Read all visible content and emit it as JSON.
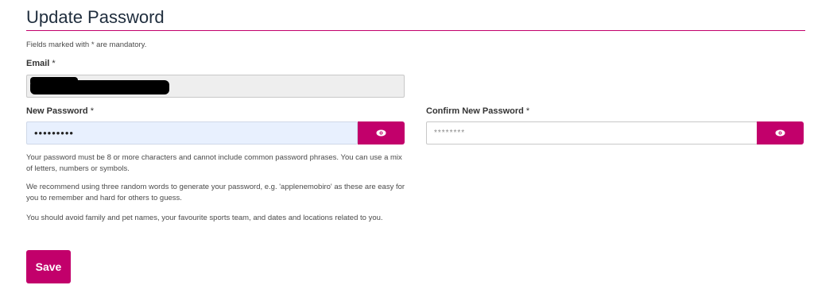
{
  "page": {
    "title": "Update Password",
    "mandatory_note": "Fields marked with * are mandatory."
  },
  "email": {
    "label": "Email",
    "required_mark": "*"
  },
  "new_password": {
    "label": "New Password",
    "required_mark": "*",
    "value": "•••••••••",
    "toggle_icon": "eye-icon"
  },
  "confirm_password": {
    "label": "Confirm New Password",
    "required_mark": "*",
    "placeholder": "********",
    "toggle_icon": "eye-icon"
  },
  "help": {
    "paragraph_1": "Your password must be 8 or more characters and cannot include common password phrases. You can use a mix of letters, numbers or symbols.",
    "paragraph_2": "We recommend using three random words to generate your password, e.g. 'applenemobiro' as these are easy for you to remember and hard for others to guess.",
    "paragraph_3": "You should avoid family and pet names, your favourite sports team, and dates and locations related to you."
  },
  "actions": {
    "save_label": "Save"
  },
  "colors": {
    "accent": "#c2006b",
    "autofill_bg": "#e8f0fe",
    "readonly_bg": "#eeeeee"
  }
}
